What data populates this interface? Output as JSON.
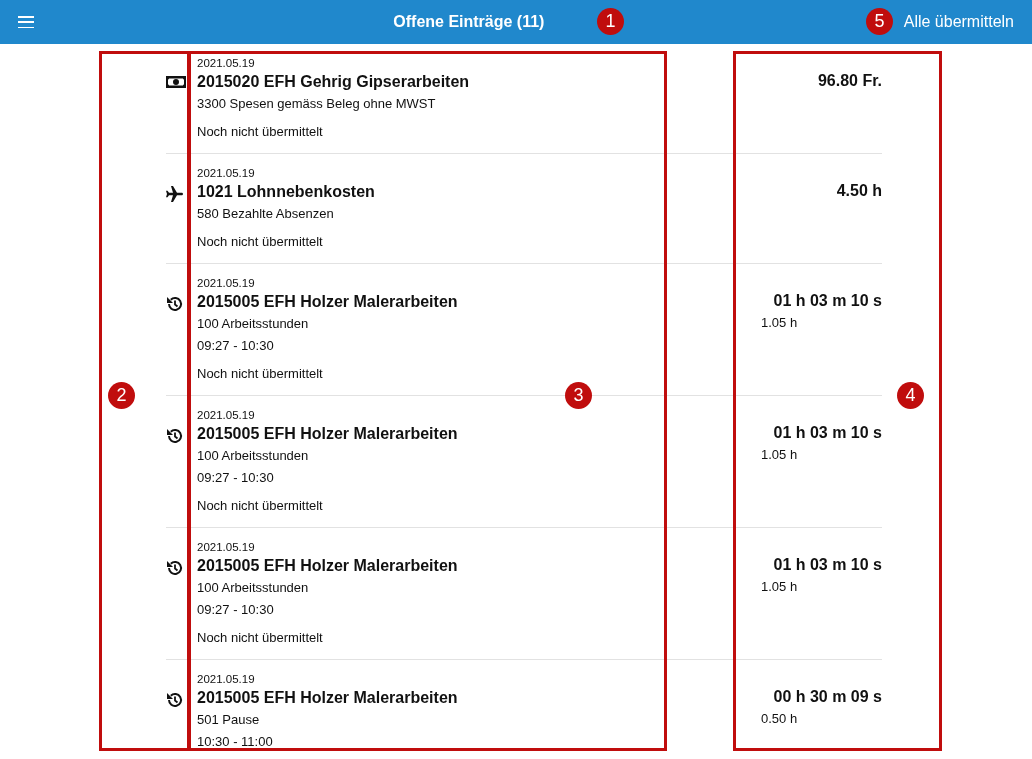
{
  "header": {
    "title": "Offene Einträge (11)",
    "action": "Alle übermitteln"
  },
  "entries": [
    {
      "kind": "expense",
      "date": "2021.05.19",
      "title": "2015020 EFH Gehrig Gipserarbeiten",
      "subtitle": "3300 Spesen gemäss Beleg ohne MWST",
      "status": "Noch nicht übermittelt",
      "value": "96.80 Fr."
    },
    {
      "kind": "absence",
      "date": "2021.05.19",
      "title": "1021 Lohnnebenkosten",
      "subtitle": "580 Bezahlte Absenzen",
      "status": "Noch nicht übermittelt",
      "value": "4.50 h"
    },
    {
      "kind": "time",
      "date": "2021.05.19",
      "title": "2015005 EFH Holzer Malerarbeiten",
      "subtitle": "100 Arbeitsstunden",
      "time_range": "09:27 - 10:30",
      "status": "Noch nicht übermittelt",
      "value": "01 h 03 m 10 s",
      "value_sub": "1.05 h"
    },
    {
      "kind": "time",
      "date": "2021.05.19",
      "title": "2015005 EFH Holzer Malerarbeiten",
      "subtitle": "100 Arbeitsstunden",
      "time_range": "09:27 - 10:30",
      "status": "Noch nicht übermittelt",
      "value": "01 h 03 m 10 s",
      "value_sub": "1.05 h"
    },
    {
      "kind": "time",
      "date": "2021.05.19",
      "title": "2015005 EFH Holzer Malerarbeiten",
      "subtitle": "100 Arbeitsstunden",
      "time_range": "09:27 - 10:30",
      "status": "Noch nicht übermittelt",
      "value": "01 h 03 m 10 s",
      "value_sub": "1.05 h"
    },
    {
      "kind": "time",
      "date": "2021.05.19",
      "title": "2015005 EFH Holzer Malerarbeiten",
      "subtitle": "501 Pause",
      "time_range": "10:30 - 11:00",
      "value": "00 h 30 m 09 s",
      "value_sub": "0.50 h"
    }
  ],
  "annotations": [
    {
      "label": "1"
    },
    {
      "label": "2"
    },
    {
      "label": "3"
    },
    {
      "label": "4"
    },
    {
      "label": "5"
    }
  ]
}
